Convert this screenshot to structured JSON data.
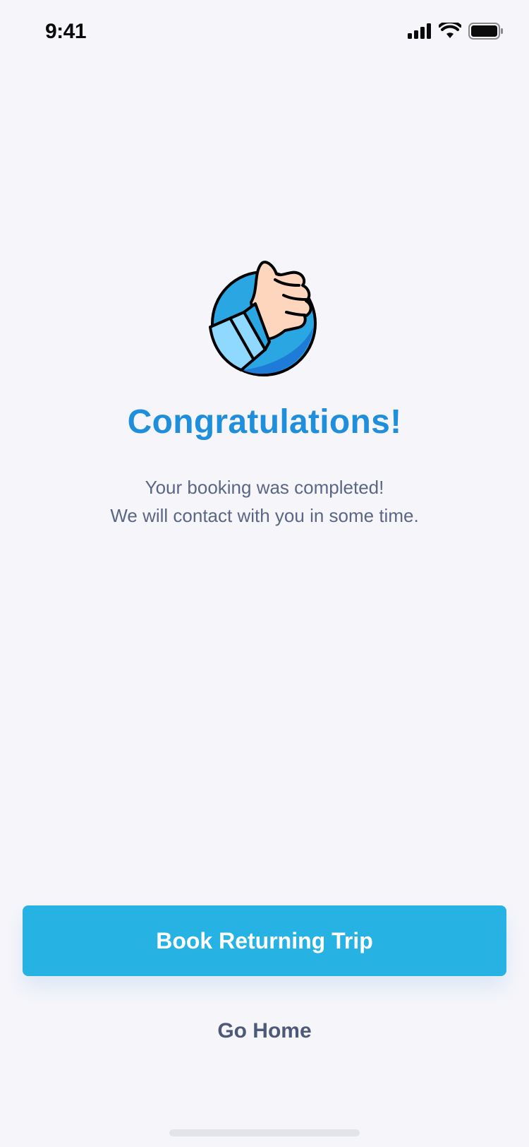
{
  "status_bar": {
    "time": "9:41",
    "icons": [
      "cellular-signal-icon",
      "wifi-icon",
      "battery-icon"
    ]
  },
  "hero": {
    "icon": "thumbs-up-icon"
  },
  "content": {
    "title": "Congratulations!",
    "message_line1": "Your booking was completed!",
    "message_line2": "We will contact with you in some time."
  },
  "actions": {
    "primary_label": "Book Returning Trip",
    "secondary_label": "Go Home"
  },
  "colors": {
    "background": "#F6F6FA",
    "title": "#1F8FDC",
    "primary_button": "#26B2E2",
    "secondary_text": "#4E5877",
    "body_text": "#5B6685"
  }
}
